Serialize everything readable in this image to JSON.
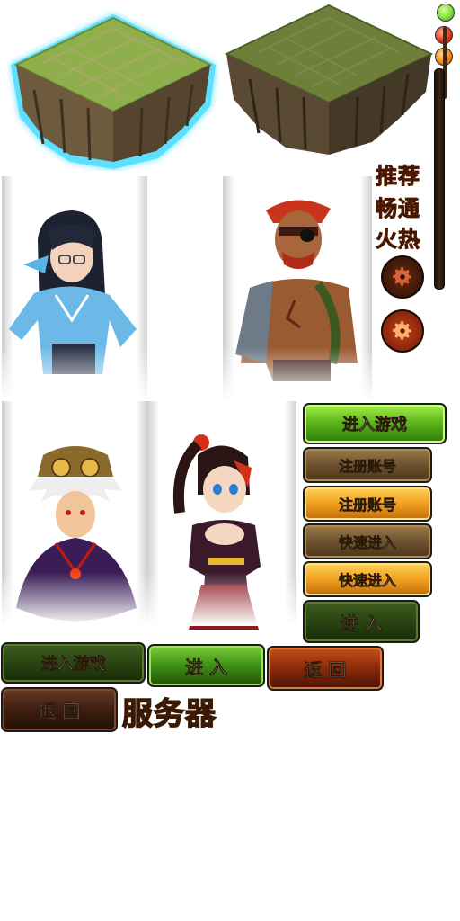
{
  "servers": {
    "selected_island": "island-selected",
    "other_island": "island-normal"
  },
  "status": {
    "dots": [
      "#7ee03a",
      "#e03a1a",
      "#f08a1a"
    ],
    "tags": [
      {
        "label": "推荐",
        "color": "#7edc2a"
      },
      {
        "label": "畅通",
        "color": "#f0b020"
      },
      {
        "label": "火热",
        "color": "#e83a10"
      }
    ]
  },
  "characters": [
    {
      "name": "girl-glasses"
    },
    {
      "name": "pirate-warrior"
    },
    {
      "name": "owl-helmet-boy"
    },
    {
      "name": "ponytail-girl"
    }
  ],
  "buttons": {
    "enter_game_bright": "进入游戏",
    "register_dark": "注册账号",
    "register_bright": "注册账号",
    "quick_enter_dark": "快速进入",
    "quick_enter_bright": "快速进入",
    "enter_dark": "进 入",
    "enter_game_dark": "进入游戏",
    "enter_bright": "进 入",
    "back_bright": "返 回",
    "back_dark": "返 回"
  },
  "server_label": "服务器"
}
